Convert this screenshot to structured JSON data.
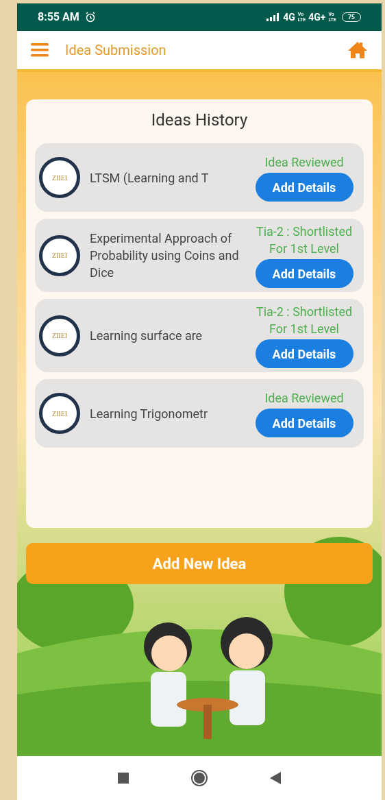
{
  "status_bar": {
    "time": "8:55 AM",
    "networks": [
      {
        "label": "4G",
        "tag_top": "Vo",
        "tag_bottom": "LTE"
      },
      {
        "label": "4G+",
        "tag_top": "Vo",
        "tag_bottom": "LTE"
      }
    ],
    "battery": "75"
  },
  "app_bar": {
    "title": "Idea Submission"
  },
  "history": {
    "title": "Ideas History",
    "items": [
      {
        "logo_text": "ZIIEI",
        "title": "LTSM (Learning and T",
        "status": "Idea Reviewed",
        "action": "Add Details"
      },
      {
        "logo_text": "ZIIEI",
        "title": "Experimental Approach of Probability using Coins and Dice",
        "status": "Tia-2 : Shortlisted For 1st Level",
        "action": "Add Details"
      },
      {
        "logo_text": "ZIIEI",
        "title": "Learning surface are",
        "status": "Tia-2 : Shortlisted For 1st Level",
        "action": "Add Details"
      },
      {
        "logo_text": "ZIIEI",
        "title": "Learning Trigonometr",
        "status": "Idea Reviewed",
        "action": "Add Details"
      }
    ]
  },
  "primary_button": "Add New Idea"
}
